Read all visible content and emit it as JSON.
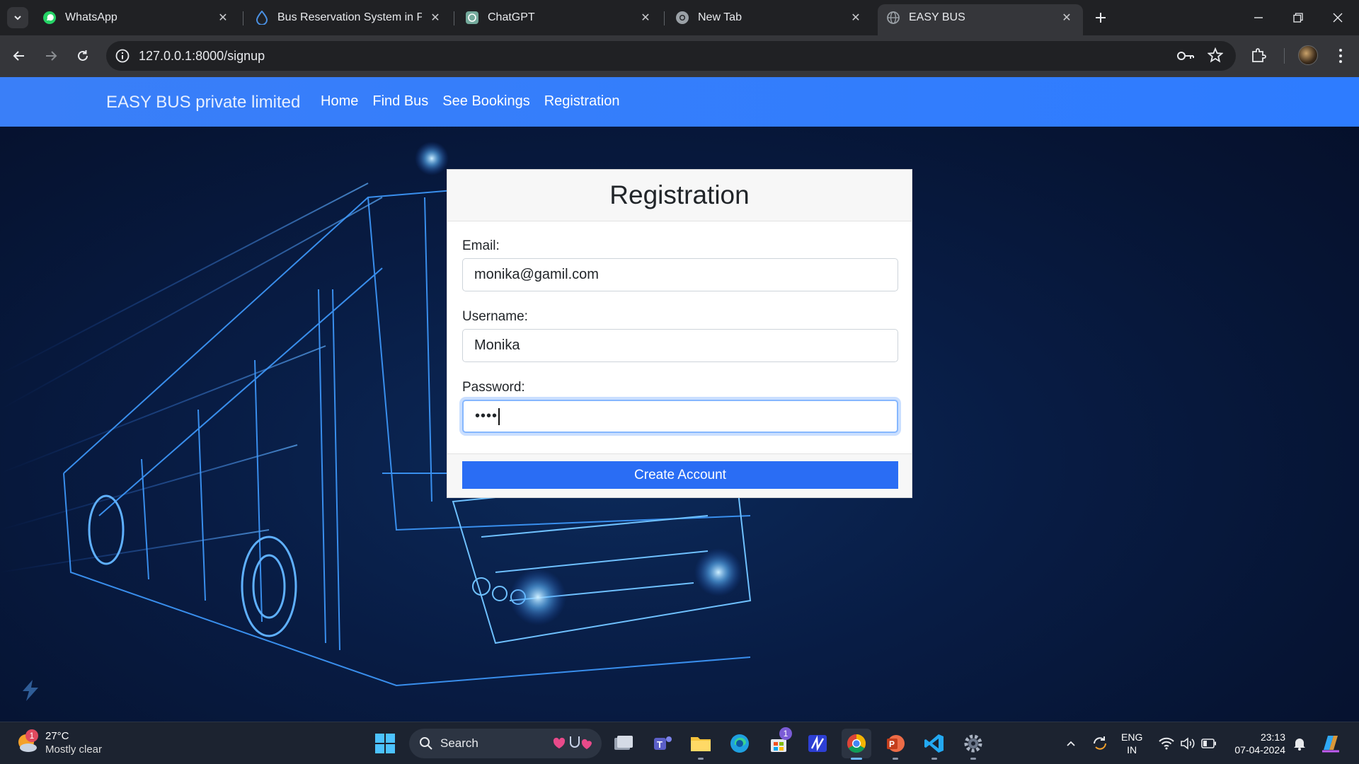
{
  "browser": {
    "tabs": [
      {
        "title": "WhatsApp",
        "active": false
      },
      {
        "title": "Bus Reservation System in Pyth",
        "active": false
      },
      {
        "title": "ChatGPT",
        "active": false
      },
      {
        "title": "New Tab",
        "active": false
      },
      {
        "title": "EASY BUS",
        "active": true
      }
    ],
    "url": "127.0.0.1:8000/signup"
  },
  "navbar": {
    "brand": "EASY BUS private limited",
    "links": [
      "Home",
      "Find Bus",
      "See Bookings",
      "Registration"
    ]
  },
  "form": {
    "title": "Registration",
    "email_label": "Email:",
    "email_value": "monika@gamil.com",
    "username_label": "Username:",
    "username_value": "Monika",
    "password_label": "Password:",
    "password_value": "••••",
    "submit_label": "Create Account"
  },
  "taskbar": {
    "weather_temp": "27°C",
    "weather_desc": "Mostly clear",
    "weather_badge": "1",
    "search_label": "Search",
    "store_badge": "1",
    "lang_line1": "ENG",
    "lang_line2": "IN",
    "time": "23:13",
    "date": "07-04-2024"
  },
  "colors": {
    "navbar": "#2e7cff",
    "button": "#2a6df4",
    "page_bg": "#061433"
  }
}
